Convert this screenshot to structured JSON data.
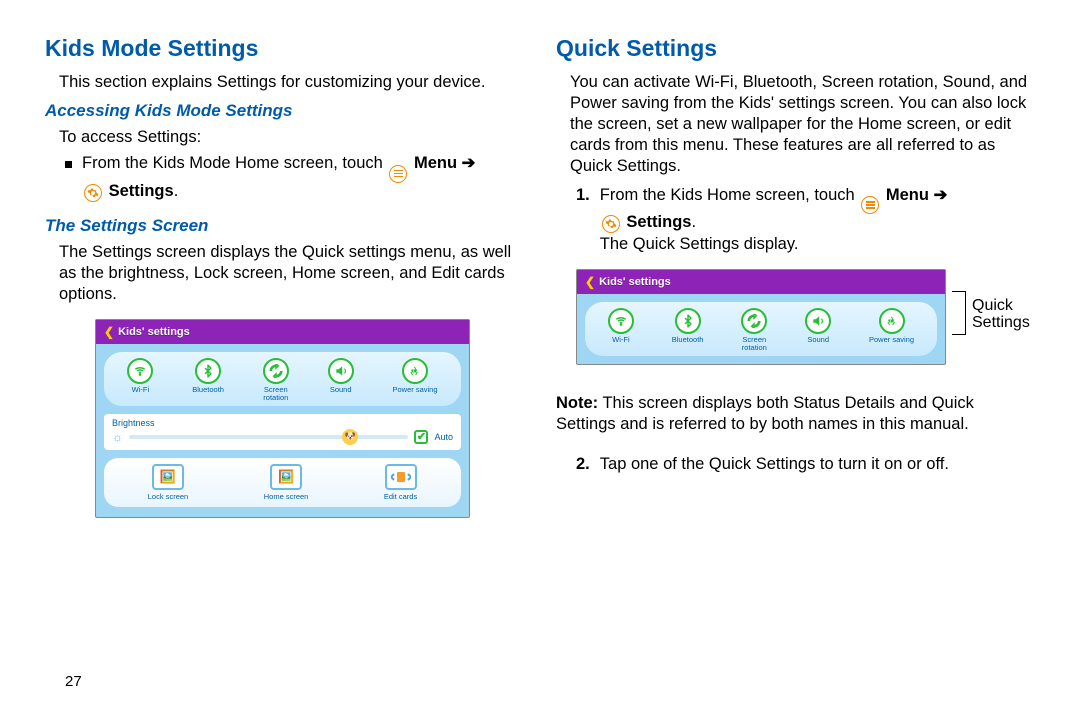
{
  "left": {
    "h1": "Kids Mode Settings",
    "intro": "This section explains Settings for customizing your device.",
    "h2a": "Accessing Kids Mode Settings",
    "access_line": "To access Settings:",
    "bullet_pre": "From the Kids Mode Home screen, touch",
    "menu_word": "Menu",
    "arrow": "➔",
    "settings_word": "Settings",
    "h2b": "The Settings Screen",
    "settings_desc": "The Settings screen displays the Quick settings menu, as well as the brightness, Lock screen, Home screen, and Edit cards options."
  },
  "right": {
    "h1": "Quick Settings",
    "intro": "You can activate Wi-Fi, Bluetooth, Screen rotation, Sound, and Power saving from the Kids' settings screen. You can also lock the screen, set a new wallpaper for the Home screen, or edit cards from this menu. These features are all referred to as Quick Settings.",
    "step1_pre": "From the Kids Home screen, touch",
    "menu_word": "Menu",
    "arrow": "➔",
    "settings_word": "Settings",
    "step1_post": "The Quick Settings display.",
    "annot_line1": "Quick",
    "annot_line2": "Settings",
    "note_label": "Note:",
    "note_text": " This screen displays both Status Details and Quick Settings and is referred to by both names in this manual.",
    "step2": "Tap one of the Quick Settings to turn it on or off."
  },
  "shot": {
    "title": "Kids' settings",
    "qs": {
      "wifi": "Wi-Fi",
      "bluetooth": "Bluetooth",
      "rotation_l1": "Screen",
      "rotation_l2": "rotation",
      "sound": "Sound",
      "power": "Power saving"
    },
    "brightness_title": "Brightness",
    "auto": "Auto",
    "lock": "Lock screen",
    "home": "Home screen",
    "edit": "Edit cards"
  },
  "page_number": "27",
  "steps": {
    "one": "1.",
    "two": "2."
  }
}
